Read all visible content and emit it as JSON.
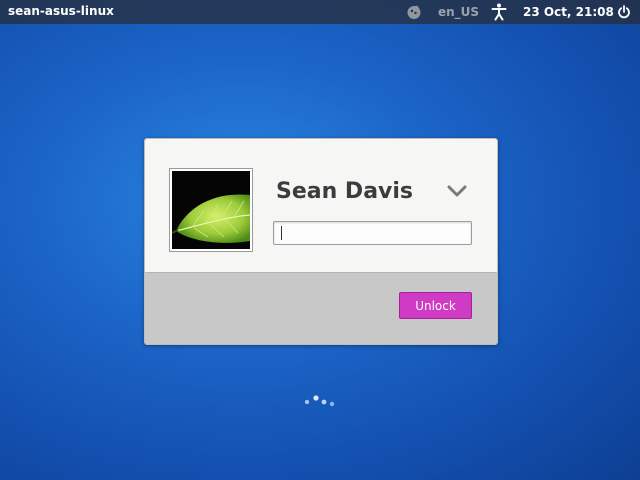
{
  "topbar": {
    "hostname": "sean-asus-linux",
    "keyboard_icon": "keyboard-icon",
    "language": "en_US",
    "accessibility_icon": "accessibility-icon",
    "clock": "23 Oct, 21:08",
    "power_icon": "power-icon"
  },
  "login": {
    "avatar_icon": "leaf-avatar",
    "username": "Sean Davis",
    "user_menu_icon": "chevron-down-icon",
    "password": {
      "value": "",
      "placeholder": ""
    },
    "unlock_label": "Unlock"
  },
  "spinner_icon": "loading-spinner-icon",
  "colors": {
    "accent": "#d03bc6",
    "topbar": "#2c3038",
    "background": "#1c66c9"
  }
}
